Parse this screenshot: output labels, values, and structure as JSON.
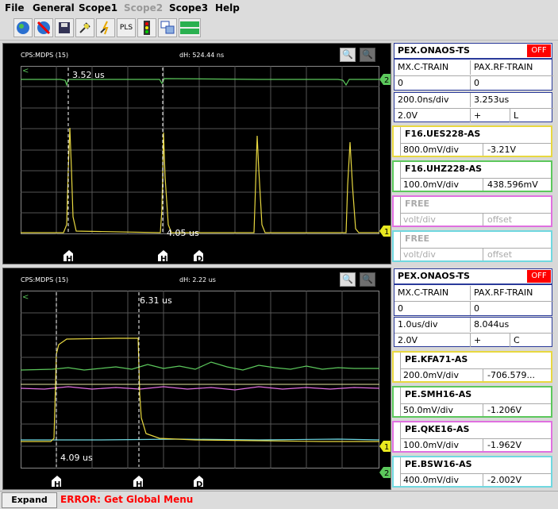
{
  "menu": [
    "File",
    "General",
    "Scope1",
    "Scope2",
    "Scope3",
    "Help"
  ],
  "toolbar": {
    "pls_label": "PLS"
  },
  "scopes": [
    {
      "header_left": "CPS:MDPS (15)",
      "header_dh": "dH: 524.44 ns",
      "cursor_top_label": "3.52 us",
      "cursor_bottom_label": "4.05 us",
      "right_markers": [
        "2",
        "1"
      ],
      "bottom_markers": [
        "H",
        "H",
        "D"
      ],
      "panel": {
        "source": "PEX.ONAOS-TS",
        "off_label": "OFF",
        "train_a": "MX.C-TRAIN",
        "train_b": "PAX.RF-TRAIN",
        "val_a": "0",
        "val_b": "0",
        "timebase": "200.0ns/div",
        "delay": "3.253us",
        "trig_level": "2.0V",
        "trig_slope": "+",
        "trig_mode": "L",
        "channels": [
          {
            "name": "F16.UES228-AS",
            "scale": "800.0mV/div",
            "offset": "-3.21V",
            "color": "#e8d840"
          },
          {
            "name": "F16.UHZ228-AS",
            "scale": "100.0mV/div",
            "offset": "438.596mV",
            "color": "#5cc85c"
          },
          {
            "name": "FREE",
            "scale": "volt/div",
            "offset": "offset",
            "color": "#e070e0"
          },
          {
            "name": "FREE",
            "scale": "volt/div",
            "offset": "offset",
            "color": "#70d8e0"
          }
        ]
      }
    },
    {
      "header_left": "CPS:MDPS (15)",
      "header_dh": "dH: 2.22 us",
      "cursor_top_label": "6.31 us",
      "cursor_bottom_label": "4.09 us",
      "right_markers": [
        "1",
        "2"
      ],
      "bottom_markers": [
        "H",
        "H",
        "D"
      ],
      "panel": {
        "source": "PEX.ONAOS-TS",
        "off_label": "OFF",
        "train_a": "MX.C-TRAIN",
        "train_b": "PAX.RF-TRAIN",
        "val_a": "0",
        "val_b": "0",
        "timebase": "1.0us/div",
        "delay": "8.044us",
        "trig_level": "2.0V",
        "trig_slope": "+",
        "trig_mode": "C",
        "channels": [
          {
            "name": "PE.KFA71-AS",
            "scale": "200.0mV/div",
            "offset": "-706.579...",
            "color": "#e8d840"
          },
          {
            "name": "PE.SMH16-AS",
            "scale": "50.0mV/div",
            "offset": "-1.206V",
            "color": "#5cc85c"
          },
          {
            "name": "PE.QKE16-AS",
            "scale": "100.0mV/div",
            "offset": "-1.962V",
            "color": "#e070e0"
          },
          {
            "name": "PE.BSW16-AS",
            "scale": "400.0mV/div",
            "offset": "-2.002V",
            "color": "#70d8e0"
          }
        ]
      }
    }
  ],
  "status": {
    "expand_label": "Expand",
    "error_text": "ERROR: Get Global Menu"
  }
}
